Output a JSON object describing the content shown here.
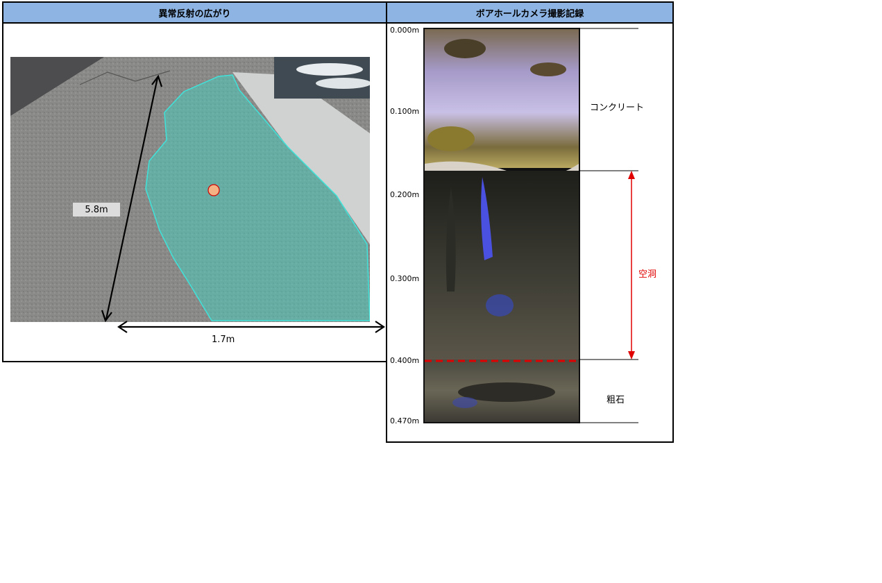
{
  "left_panel": {
    "title": "異常反射の広がり",
    "length_label": "5.8m",
    "width_label": "1.7m"
  },
  "right_panel": {
    "title": "ボアホールカメラ撮影記録",
    "depths": [
      "0.000m",
      "0.100m",
      "0.200m",
      "0.300m",
      "0.400m",
      "0.470m"
    ],
    "layers": {
      "concrete": "コンクリート",
      "cavity": "空洞",
      "rubble": "粗石"
    }
  },
  "colors": {
    "header_bg": "#8db4e2",
    "anomaly_area": "#40e0d0",
    "cavity_marker": "#e00000",
    "drill_point": "#f4b183"
  }
}
